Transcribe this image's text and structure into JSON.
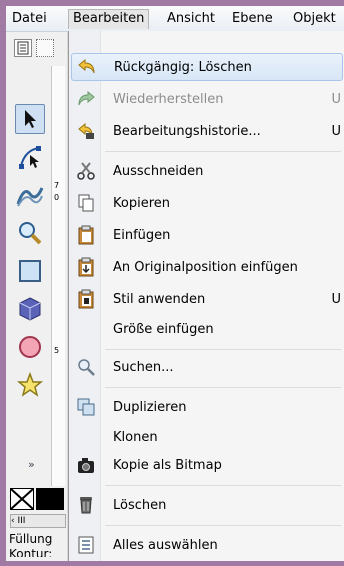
{
  "menubar": {
    "items": [
      {
        "label": "Datei",
        "open": false
      },
      {
        "label": "Bearbeiten",
        "open": true
      },
      {
        "label": "Ansicht",
        "open": false
      },
      {
        "label": "Ebene",
        "open": false
      },
      {
        "label": "Objekt",
        "open": false
      }
    ]
  },
  "toolbox": {
    "more_label": "»",
    "scroll_label": "‹ III",
    "fill_label": "Füllung",
    "stroke_label": "Kontur:",
    "ruler_ticks": [
      "7",
      "0",
      "5"
    ]
  },
  "edit_menu": {
    "items": [
      {
        "label": "Rückgängig: Löschen",
        "icon": "undo-icon",
        "shortcut": "",
        "disabled": false,
        "highlighted": true
      },
      {
        "label": "Wiederherstellen",
        "icon": "redo-icon",
        "shortcut": "U",
        "disabled": true,
        "highlighted": false
      },
      {
        "label": "Bearbeitungshistorie...",
        "icon": "history-icon",
        "shortcut": "U",
        "disabled": false,
        "highlighted": false
      },
      {
        "label": "Ausschneiden",
        "icon": "scissors-icon",
        "shortcut": "",
        "disabled": false,
        "highlighted": false
      },
      {
        "label": "Kopieren",
        "icon": "copy-icon",
        "shortcut": "",
        "disabled": false,
        "highlighted": false
      },
      {
        "label": "Einfügen",
        "icon": "paste-icon",
        "shortcut": "",
        "disabled": false,
        "highlighted": false
      },
      {
        "label": "An Originalposition einfügen",
        "icon": "paste-in-place-icon",
        "shortcut": "",
        "disabled": false,
        "highlighted": false
      },
      {
        "label": "Stil anwenden",
        "icon": "paste-style-icon",
        "shortcut": "U",
        "disabled": false,
        "highlighted": false
      },
      {
        "label": "Größe einfügen",
        "icon": "",
        "shortcut": "",
        "disabled": false,
        "highlighted": false
      },
      {
        "label": "Suchen...",
        "icon": "find-icon",
        "shortcut": "",
        "disabled": false,
        "highlighted": false
      },
      {
        "label": "Duplizieren",
        "icon": "duplicate-icon",
        "shortcut": "",
        "disabled": false,
        "highlighted": false
      },
      {
        "label": "Klonen",
        "icon": "",
        "shortcut": "",
        "disabled": false,
        "highlighted": false
      },
      {
        "label": "Kopie als Bitmap",
        "icon": "bitmap-copy-icon",
        "shortcut": "",
        "disabled": false,
        "highlighted": false
      },
      {
        "label": "Löschen",
        "icon": "trash-icon",
        "shortcut": "",
        "disabled": false,
        "highlighted": false
      },
      {
        "label": "Alles auswählen",
        "icon": "select-all-icon",
        "shortcut": "",
        "disabled": false,
        "highlighted": false
      }
    ]
  },
  "colors": {
    "window_border": "#a07aa3",
    "highlight": "#d7e6f6",
    "disabled_text": "#8d8d8d"
  }
}
